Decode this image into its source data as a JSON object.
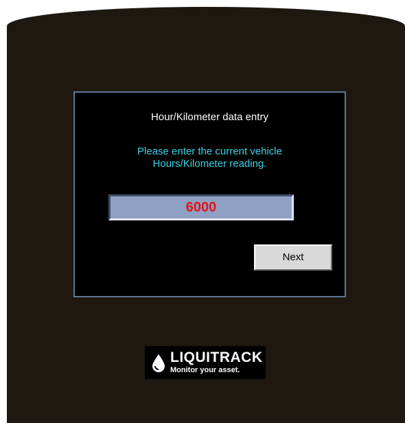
{
  "dialog": {
    "title": "Hour/Kilometer data entry",
    "prompt_line1": "Please enter the current vehicle",
    "prompt_line2": "Hours/Kilometer reading.",
    "reading_value": "6000",
    "next_label": "Next"
  },
  "branding": {
    "logo_name": "LIQUITRACK",
    "tagline": "Monitor your asset.",
    "logo_icon": "droplet-icon"
  },
  "colors": {
    "device_background": "#1e1811",
    "dialog_border": "#5f7796",
    "prompt_text": "#3cd2e6",
    "input_background": "#8ea0c3",
    "input_text": "#e01515",
    "button_background": "#d9d9d9"
  }
}
